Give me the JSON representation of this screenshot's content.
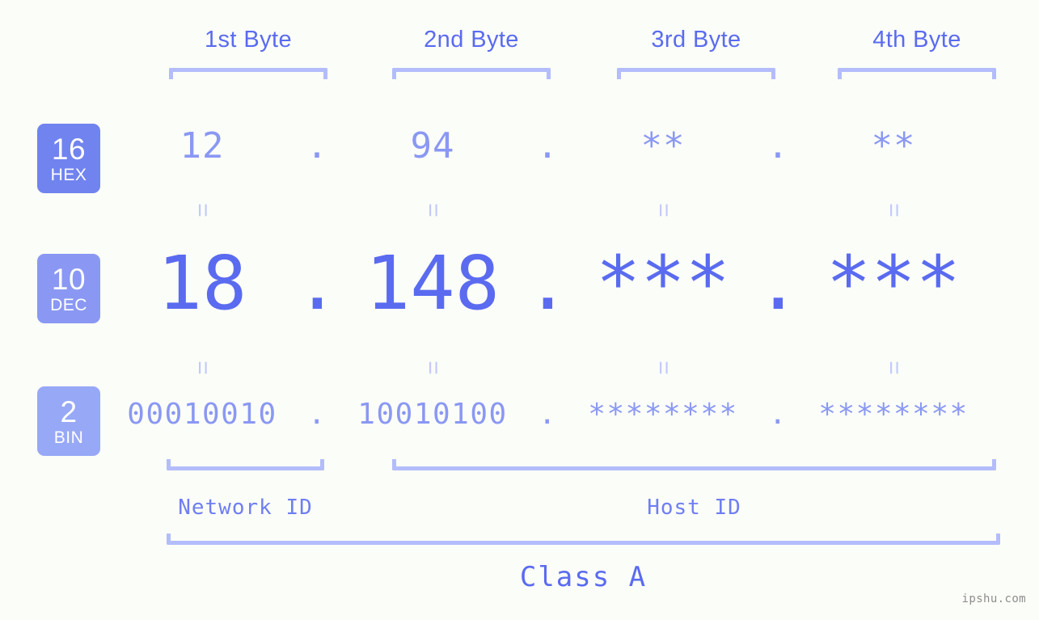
{
  "background_color": "#fbfdf8",
  "accent_color": "#5a6bf0",
  "accent_light": "#8a98f3",
  "bracket_color": "#b3bdfb",
  "byte_headers": [
    {
      "label": "1st Byte"
    },
    {
      "label": "2nd Byte"
    },
    {
      "label": "3rd Byte"
    },
    {
      "label": "4th Byte"
    }
  ],
  "bases": [
    {
      "number": "16",
      "name": "HEX",
      "color": "#7183ef"
    },
    {
      "number": "10",
      "name": "DEC",
      "color": "#8a98f3"
    },
    {
      "number": "2",
      "name": "BIN",
      "color": "#97a8f7"
    }
  ],
  "separator": ".",
  "equals_mark": "=",
  "rows": {
    "hex": {
      "base_label": "HEX",
      "values": [
        "12",
        "94",
        "**",
        "**"
      ]
    },
    "dec": {
      "base_label": "DEC",
      "values": [
        "18",
        "148",
        "***",
        "***"
      ]
    },
    "bin": {
      "base_label": "BIN",
      "values": [
        "00010010",
        "10010100",
        "********",
        "********"
      ]
    }
  },
  "segments": {
    "network_id": "Network ID",
    "host_id": "Host ID"
  },
  "class_label": "Class A",
  "watermark": "ipshu.com"
}
